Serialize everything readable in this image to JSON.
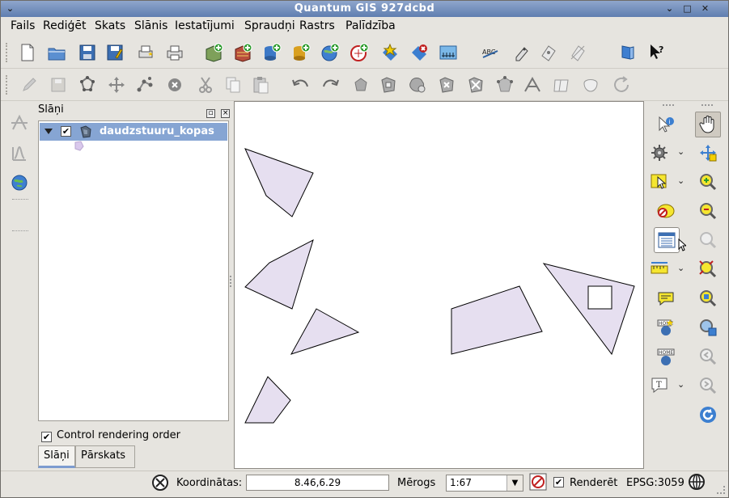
{
  "window": {
    "title": "Quantum GIS 927dcbd"
  },
  "titlebar_buttons": {
    "left": "⌄",
    "minimize": "⌄",
    "maximize": "□",
    "close": "✕"
  },
  "menu": [
    {
      "id": "fails",
      "label": "Fails"
    },
    {
      "id": "rediget",
      "label": "Rediģēt"
    },
    {
      "id": "skats",
      "label": "Skats"
    },
    {
      "id": "slanis",
      "label": "Slānis"
    },
    {
      "id": "iestatijumi",
      "label": "Iestatījumi"
    },
    {
      "id": "spraudni",
      "label": "Spraudņi"
    },
    {
      "id": "rastrs",
      "label": "Rastrs"
    },
    {
      "id": "palidziba",
      "label": "Palīdzība"
    }
  ],
  "layers_panel": {
    "title": "Slāņi",
    "layer_name": "daudzstuuru_kopas",
    "layer_visible": true,
    "control_rendering_order_label": "Control rendering order",
    "control_rendering_order": true,
    "tabs": [
      "Slāņi",
      "Pārskats"
    ],
    "active_tab": "Slāņi"
  },
  "map": {
    "fill_color": "#e6dff0",
    "stroke_color": "#000000"
  },
  "statusbar": {
    "coords_label": "Koordinātas:",
    "coords_value": "8.46,6.29",
    "scale_label": "Mērogs",
    "scale_value": "1:67",
    "render_label": "Renderēt",
    "render_checked": true,
    "crs": "EPSG:3059"
  }
}
